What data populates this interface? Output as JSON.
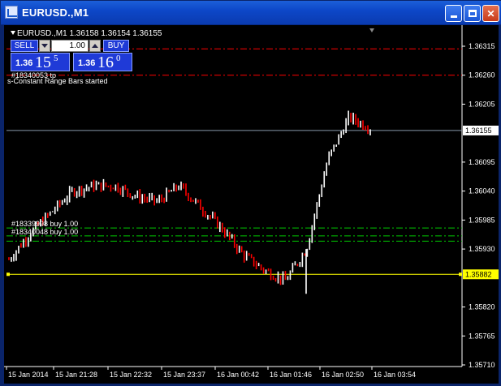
{
  "window": {
    "title": "EURUSD.,M1",
    "icon": "chart-window-icon",
    "controls": [
      "minimize",
      "maximize",
      "close"
    ]
  },
  "chart": {
    "symbol_label": "EURUSD.,M1  1.36158 1.36154 1.36155",
    "colors": {
      "background": "#000000",
      "bull_candle": "#ffffff",
      "bear_candle": "#ff0000",
      "axis": "#ffffff",
      "bid_line": "#8899aa",
      "red_dash": "#ff0000",
      "green_dash": "#00cc00",
      "yellow_line": "#ffff00"
    },
    "trade_panel": {
      "sell_label": "SELL",
      "buy_label": "BUY",
      "volume": "1.00",
      "sell_price_small": "1.36",
      "sell_price_big": "15",
      "sell_price_sup": "5",
      "buy_price_small": "1.36",
      "buy_price_big": "16",
      "buy_price_sup": "0"
    },
    "labels": {
      "tp_order": "#18340053 tp",
      "script_status": "s-Constant Range Bars started",
      "order_a": "#18339998 buy 1.00",
      "order_b": "#18340048 buy 1.00"
    },
    "price_axis": [
      "1.36315",
      "1.36260",
      "1.36205",
      "1.36155",
      "1.36095",
      "1.36040",
      "1.35985",
      "1.35930",
      "1.35882",
      "1.35820",
      "1.35765",
      "1.35710"
    ],
    "current_price": "1.36155",
    "marker_price": "1.35882",
    "time_axis": [
      "15 Jan 2014",
      "15 Jan 21:28",
      "15 Jan 22:32",
      "15 Jan 23:37",
      "16 Jan 00:42",
      "16 Jan 01:46",
      "16 Jan 02:50",
      "16 Jan 03:54"
    ]
  },
  "chart_data": {
    "type": "line",
    "title": "EURUSD.,M1",
    "ylim": [
      1.3568,
      1.3635
    ],
    "x": [
      "15 Jan 2014",
      "15 Jan 21:28",
      "15 Jan 22:32",
      "15 Jan 23:37",
      "16 Jan 00:42",
      "16 Jan 01:46",
      "16 Jan 02:50",
      "16 Jan 03:54"
    ],
    "series": [
      {
        "values": [
          1.3591,
          1.3596,
          1.36,
          1.3604,
          1.3605,
          1.3605,
          1.3603,
          1.3602,
          1.3605,
          1.3601,
          1.3597,
          1.3592,
          1.3589,
          1.3587,
          1.3593,
          1.361,
          1.3618,
          1.3616
        ]
      }
    ],
    "horizontal_lines": {
      "current_price": 1.36155,
      "marker": 1.35882,
      "take_profit": [
        1.3631,
        1.3626
      ],
      "buy_orders": [
        1.3597,
        1.35955,
        1.35945
      ]
    }
  }
}
